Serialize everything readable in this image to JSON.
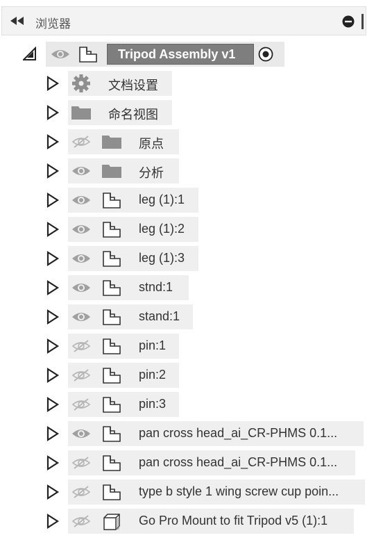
{
  "browser": {
    "title": "浏览器"
  },
  "root": {
    "label": "Tripod Assembly v1"
  },
  "items": [
    {
      "label": "文档设置",
      "icon": "gear-icon",
      "eye": "none"
    },
    {
      "label": "命名视图",
      "icon": "folder-icon",
      "eye": "none"
    },
    {
      "label": "原点",
      "icon": "folder-icon",
      "eye": "hidden"
    },
    {
      "label": "分析",
      "icon": "folder-icon",
      "eye": "visible"
    },
    {
      "label": "leg (1):1",
      "icon": "component-icon",
      "eye": "visible"
    },
    {
      "label": "leg (1):2",
      "icon": "component-icon",
      "eye": "visible"
    },
    {
      "label": "leg (1):3",
      "icon": "component-icon",
      "eye": "visible"
    },
    {
      "label": "stnd:1",
      "icon": "component-icon",
      "eye": "visible"
    },
    {
      "label": "stand:1",
      "icon": "component-icon",
      "eye": "visible"
    },
    {
      "label": "pin:1",
      "icon": "component-icon",
      "eye": "hidden"
    },
    {
      "label": "pin:2",
      "icon": "component-icon",
      "eye": "hidden"
    },
    {
      "label": "pin:3",
      "icon": "component-icon",
      "eye": "hidden"
    },
    {
      "label": "pan cross head_ai_CR-PHMS 0.1...",
      "icon": "component-icon",
      "eye": "visible"
    },
    {
      "label": "pan cross head_ai_CR-PHMS 0.1...",
      "icon": "component-icon",
      "eye": "hidden"
    },
    {
      "label": "type b style 1 wing screw cup poin...",
      "icon": "component-icon",
      "eye": "hidden"
    },
    {
      "label": "Go Pro Mount to fit Tripod v5 (1):1",
      "icon": "body-icon",
      "eye": "hidden"
    }
  ],
  "colors": {
    "pill_bg": "#efefef",
    "root_badge_bg": "#7e7e7e",
    "icon_gray": "#8f8f8f"
  }
}
